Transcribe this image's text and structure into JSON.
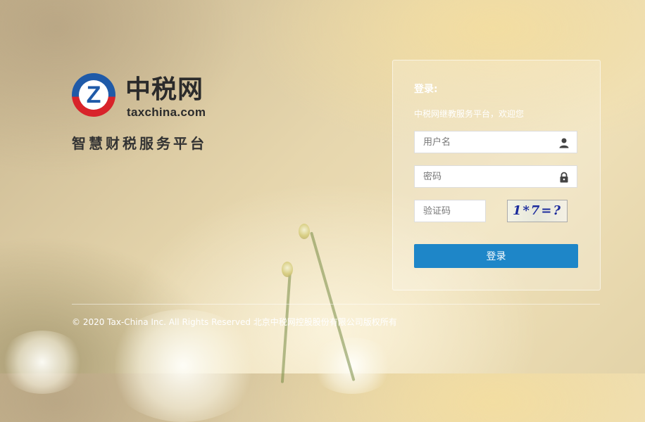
{
  "brand": {
    "logo_letter": "Z",
    "name": "中税网",
    "domain": "taxchina.com",
    "slogan": "智慧财税服务平台"
  },
  "login": {
    "title": "登录:",
    "welcome": "中税网继教服务平台，欢迎您",
    "username_placeholder": "用户名",
    "password_placeholder": "密码",
    "captcha_placeholder": "验证码",
    "captcha_text": "1*7=?",
    "submit_label": "登录"
  },
  "footer": {
    "copyright": "© 2020 Tax-China Inc. All Rights Reserved 北京中税网控股股份有限公司版权所有"
  },
  "icons": {
    "username": "user-icon",
    "password": "lock-icon"
  },
  "colors": {
    "accent": "#1e86c8",
    "logo_blue": "#1f5aa8",
    "logo_red": "#d8232a"
  }
}
